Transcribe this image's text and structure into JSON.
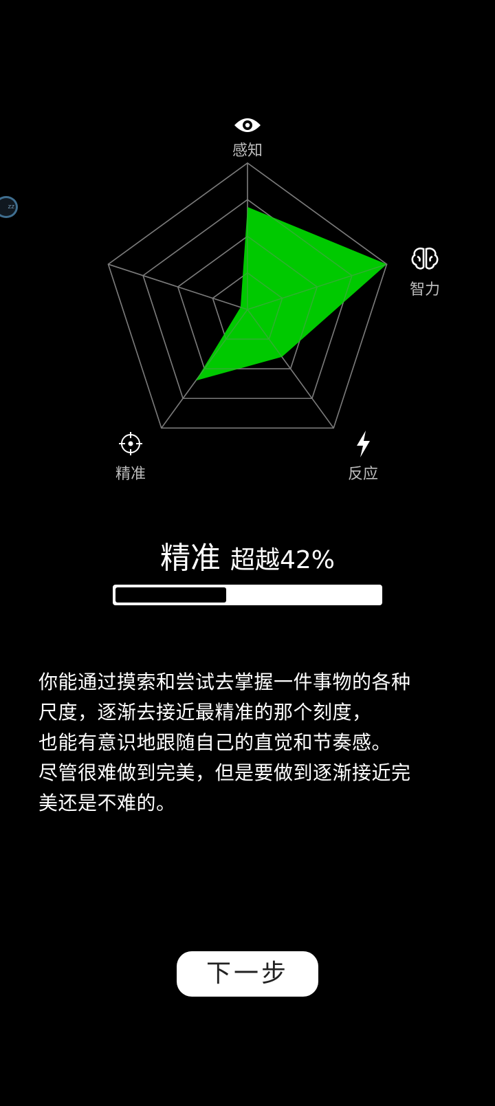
{
  "chart_data": {
    "type": "radar",
    "axes": [
      {
        "label": "感知",
        "icon": "eye-icon",
        "value": 0.7
      },
      {
        "label": "智力",
        "icon": "brain-icon",
        "value": 1.0
      },
      {
        "label": "反应",
        "icon": "lightning-icon",
        "value": 0.4
      },
      {
        "label": "精准",
        "icon": "crosshair-icon",
        "value": 0.6
      },
      {
        "label": "",
        "icon": "",
        "value": 0.05
      }
    ],
    "rings": 4,
    "range": [
      0,
      1
    ],
    "fill_color": "#00d400",
    "grid_color": "#7a7a7a"
  },
  "badge": {
    "text": "zz"
  },
  "result": {
    "name": "精准",
    "text": "超越42%",
    "progress": 0.42
  },
  "description": [
    "你能通过摸索和尝试去掌握一件事物的各种",
    "尺度，逐渐去接近最精准的那个刻度，",
    "也能有意识地跟随自己的直觉和节奏感。",
    "尽管很难做到完美，但是要做到逐渐接近完",
    "美还是不难的。"
  ],
  "next_button": {
    "label": "下一步"
  },
  "colors": {
    "background": "#000000",
    "text": "#ffffff",
    "label": "#bdbdbd"
  }
}
